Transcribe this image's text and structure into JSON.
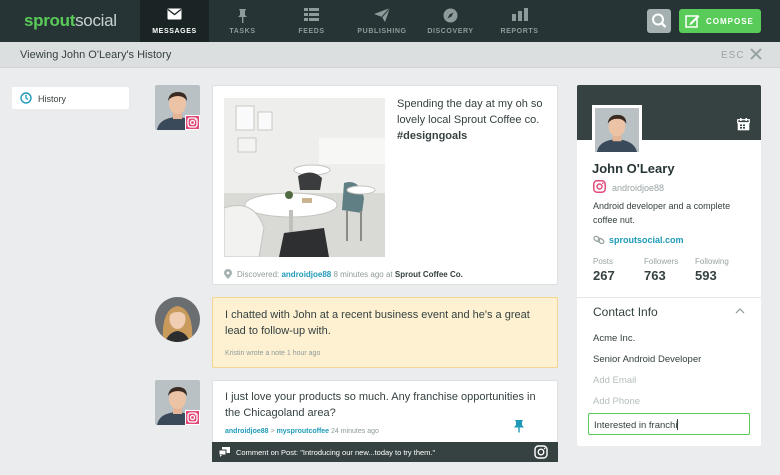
{
  "brand": {
    "sprout": "sprout",
    "social": "social"
  },
  "nav": {
    "tabs": [
      {
        "label": "MESSAGES",
        "icon": "envelope-icon"
      },
      {
        "label": "TASKS",
        "icon": "pin-icon"
      },
      {
        "label": "FEEDS",
        "icon": "feed-icon"
      },
      {
        "label": "PUBLISHING",
        "icon": "paper-plane-icon"
      },
      {
        "label": "DISCOVERY",
        "icon": "compass-icon"
      },
      {
        "label": "REPORTS",
        "icon": "bar-chart-icon"
      }
    ],
    "compose_label": "COMPOSE"
  },
  "subheader": {
    "title": "Viewing John O'Leary's History",
    "esc_label": "ESC"
  },
  "sidebar": {
    "history_label": "History"
  },
  "feed": {
    "post1": {
      "text": "Spending the day at my oh so lovely local Sprout Coffee co. ",
      "hashtag": "#designgoals",
      "meta_prefix": "Discovered: ",
      "meta_user": "androidjoe88",
      "meta_time": " 8 minutes ago at ",
      "meta_place": "Sprout Coffee Co."
    },
    "note": {
      "text": "I chatted with John at a recent business event and he's a great lead to follow-up with.",
      "byline": "Kristin wrote a note 1 hour ago"
    },
    "post2": {
      "text": "I just love your products so much. Any franchise opportunities in the Chicagoland area?",
      "meta_user": "androidjoe88",
      "meta_sep": " > ",
      "meta_target": "mysproutcoffee",
      "meta_time": " 24 minutes ago",
      "comment_bar": "Comment on Post: \"Introducing our new...today to try them.\""
    }
  },
  "profile": {
    "name": "John O'Leary",
    "handle": "androidjoe88",
    "bio": "Android developer and a complete coffee nut.",
    "link": "sproutsocial.com",
    "stats": [
      {
        "label": "Posts",
        "value": "267"
      },
      {
        "label": "Followers",
        "value": "763"
      },
      {
        "label": "Following",
        "value": "593"
      }
    ],
    "contact": {
      "title": "Contact Info",
      "company": "Acme Inc.",
      "job_title": "Senior Android Developer",
      "email_placeholder": "Add Email",
      "phone_placeholder": "Add Phone",
      "notes_value": "Interested in franchi"
    }
  },
  "colors": {
    "accent": "#59cb59",
    "nav_bg": "#273435",
    "link": "#1f9bb9",
    "instagram": "#e24a7a",
    "note_bg": "#fdf1d1"
  }
}
